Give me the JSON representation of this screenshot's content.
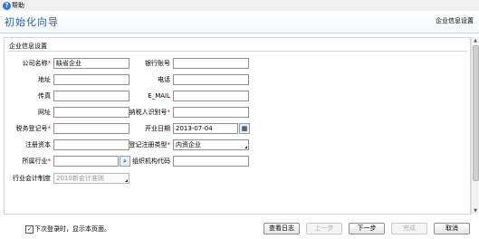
{
  "menu": {
    "help_label": "帮助"
  },
  "header": {
    "title": "初始化向导",
    "step_name": "企业信息设置"
  },
  "section": {
    "title": "企业信息设置"
  },
  "form": {
    "company_name": {
      "label": "公司名称",
      "required": "*",
      "value": "缺省企业"
    },
    "bank_account": {
      "label": "银行账号",
      "value": ""
    },
    "address": {
      "label": "地址",
      "value": ""
    },
    "phone": {
      "label": "电话",
      "value": ""
    },
    "fax": {
      "label": "传真",
      "value": ""
    },
    "email": {
      "label": "E_MAIL",
      "value": ""
    },
    "website": {
      "label": "网址",
      "value": ""
    },
    "taxpayer_id": {
      "label": "纳税人识别号",
      "required": "*",
      "value": ""
    },
    "tax_reg_no": {
      "label": "税务登记号",
      "required": "*",
      "value": ""
    },
    "open_date": {
      "label": "开业日期",
      "value": "2013-07-04"
    },
    "reg_capital": {
      "label": "注册资本",
      "value": ""
    },
    "reg_type": {
      "label": "登记注册类型",
      "required": "*",
      "value": "内资企业"
    },
    "industry": {
      "label": "所属行业",
      "required": "*",
      "value": ""
    },
    "org_code": {
      "label": "组织机构代码",
      "value": ""
    },
    "accounting_system": {
      "label": "行业会计制度",
      "value": "2010新会计准则"
    }
  },
  "footer": {
    "checkbox_label": "下次登录时，显示本页面。",
    "checkbox_checked": "✓",
    "buttons": {
      "view_log": "查看日志",
      "prev": "上一步",
      "next": "下一步",
      "finish": "完成",
      "cancel": "取消"
    }
  },
  "colors": {
    "title_blue": "#2d63a8",
    "help_icon": "#2e78c7",
    "required": "#cc0000"
  }
}
